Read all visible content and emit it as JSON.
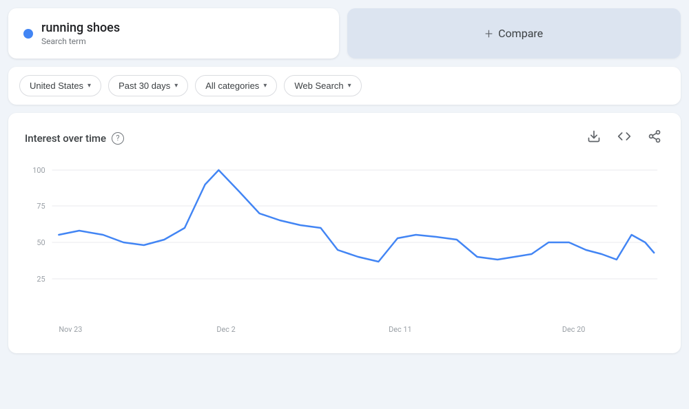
{
  "search_term": {
    "name": "running shoes",
    "label": "Search term",
    "dot_color": "#4285f4"
  },
  "compare": {
    "label": "Compare",
    "plus": "+"
  },
  "filters": [
    {
      "id": "location",
      "label": "United States",
      "has_arrow": true
    },
    {
      "id": "time_range",
      "label": "Past 30 days",
      "has_arrow": true
    },
    {
      "id": "category",
      "label": "All categories",
      "has_arrow": true
    },
    {
      "id": "search_type",
      "label": "Web Search",
      "has_arrow": true
    }
  ],
  "chart": {
    "title": "Interest over time",
    "y_axis_labels": [
      "100",
      "75",
      "50",
      "25"
    ],
    "x_axis_labels": [
      "Nov 23",
      "Dec 2",
      "Dec 11",
      "Dec 20"
    ],
    "line_color": "#4285f4"
  },
  "icons": {
    "download": "⬇",
    "embed": "<>",
    "share": "⤴",
    "help": "?",
    "arrow_down": "▾"
  }
}
